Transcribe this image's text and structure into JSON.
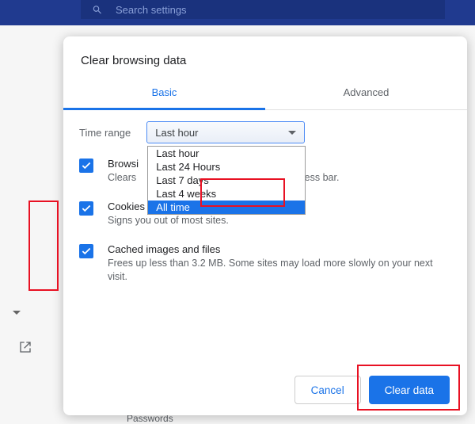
{
  "search": {
    "placeholder": "Search settings"
  },
  "dialog": {
    "title": "Clear browsing data",
    "tabs": {
      "basic": "Basic",
      "advanced": "Advanced"
    },
    "range_label": "Time range",
    "range_value": "Last hour",
    "options": {
      "o0": "Last hour",
      "o1": "Last 24 Hours",
      "o2": "Last 7 days",
      "o3": "Last 4 weeks",
      "o4": "All time"
    },
    "items": {
      "history": {
        "title_prefix": "Browsi",
        "desc_prefix": "Clears ",
        "desc_suffix": " address bar."
      },
      "cookies": {
        "title": "Cookies and other site data",
        "desc": "Signs you out of most sites."
      },
      "cache": {
        "title": "Cached images and files",
        "desc": "Frees up less than 3.2 MB. Some sites may load more slowly on your next visit."
      }
    },
    "buttons": {
      "cancel": "Cancel",
      "clear": "Clear data"
    }
  },
  "bg": {
    "passwords": "Passwords"
  }
}
